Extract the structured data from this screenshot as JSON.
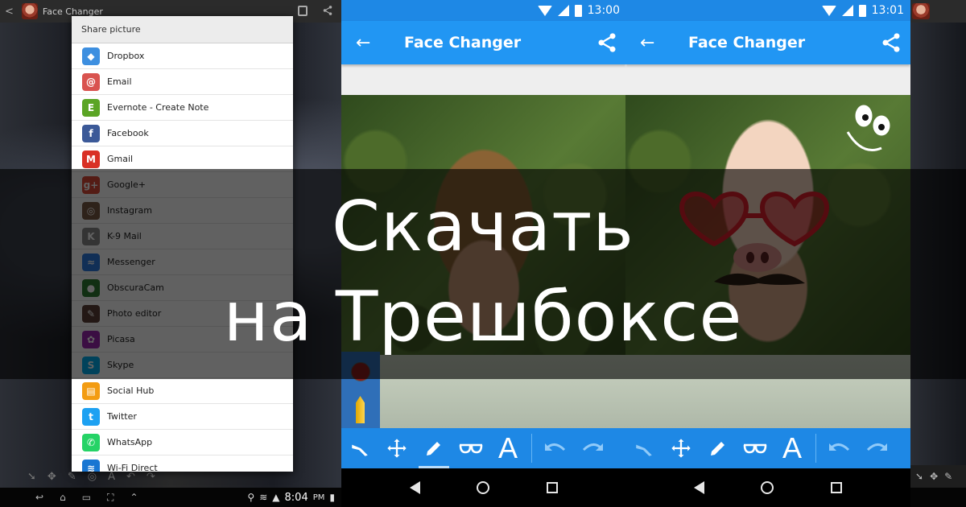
{
  "tablet": {
    "title": "Face Changer",
    "dialog_title": "Share picture",
    "share_items": [
      {
        "label": "Dropbox",
        "icon": "dropbox-icon",
        "glyph": "◆",
        "color": "#3d8fe0"
      },
      {
        "label": "Email",
        "icon": "email-icon",
        "glyph": "@",
        "color": "#d9534f"
      },
      {
        "label": "Evernote - Create Note",
        "icon": "evernote-icon",
        "glyph": "E",
        "color": "#5ba525"
      },
      {
        "label": "Facebook",
        "icon": "facebook-icon",
        "glyph": "f",
        "color": "#3b5998"
      },
      {
        "label": "Gmail",
        "icon": "gmail-icon",
        "glyph": "M",
        "color": "#d93025"
      },
      {
        "label": "Google+",
        "icon": "google-plus-icon",
        "glyph": "g+",
        "color": "#dd4b39"
      },
      {
        "label": "Instagram",
        "icon": "instagram-icon",
        "glyph": "◎",
        "color": "#7a5a45"
      },
      {
        "label": "K-9 Mail",
        "icon": "k9-mail-icon",
        "glyph": "K",
        "color": "#8a8a8a"
      },
      {
        "label": "Messenger",
        "icon": "messenger-icon",
        "glyph": "≈",
        "color": "#2f7de1"
      },
      {
        "label": "ObscuraCam",
        "icon": "obscuracam-icon",
        "glyph": "●",
        "color": "#2e7d32"
      },
      {
        "label": "Photo editor",
        "icon": "photo-editor-icon",
        "glyph": "✎",
        "color": "#5d4037"
      },
      {
        "label": "Picasa",
        "icon": "picasa-icon",
        "glyph": "✿",
        "color": "#9c27b0"
      },
      {
        "label": "Skype",
        "icon": "skype-icon",
        "glyph": "S",
        "color": "#00aff0"
      },
      {
        "label": "Social Hub",
        "icon": "social-hub-icon",
        "glyph": "▤",
        "color": "#f39c12"
      },
      {
        "label": "Twitter",
        "icon": "twitter-icon",
        "glyph": "t",
        "color": "#1da1f2"
      },
      {
        "label": "WhatsApp",
        "icon": "whatsapp-icon",
        "glyph": "✆",
        "color": "#25d366"
      },
      {
        "label": "Wi-Fi Direct",
        "icon": "wifi-direct-icon",
        "glyph": "≋",
        "color": "#1976d2"
      }
    ],
    "tool_glyphs": [
      "➘",
      "✥",
      "✎",
      "◎",
      "A",
      "↶",
      "↷"
    ],
    "status_time": "8:04",
    "status_ampm": "PM"
  },
  "phones": [
    {
      "status_time": "13:00",
      "app_title": "Face Changer",
      "back_glyph": "←"
    },
    {
      "status_time": "13:01",
      "app_title": "Face Changer",
      "back_glyph": "←"
    }
  ],
  "toolbar": {
    "text_tool_glyph": "A"
  },
  "headline": {
    "line1": "Скачать",
    "line2": "на Трешбоксе"
  },
  "colors": {
    "primary": "#2196f3",
    "primary_dark": "#1e88e5"
  }
}
